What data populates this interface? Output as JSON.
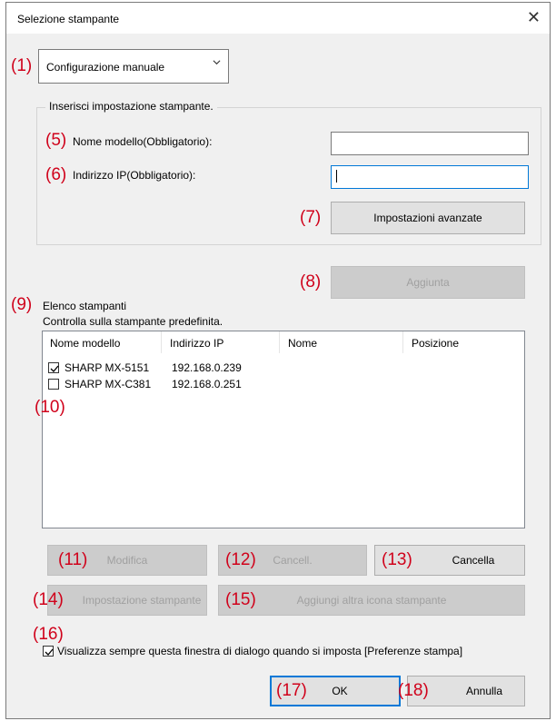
{
  "window": {
    "title": "Selezione stampante",
    "close_glyph": "✕"
  },
  "markers": {
    "m1": "(1)",
    "m5": "(5)",
    "m6": "(6)",
    "m7": "(7)",
    "m8": "(8)",
    "m9": "(9)",
    "m10": "(10)",
    "m11": "(11)",
    "m12": "(12)",
    "m13": "(13)",
    "m14": "(14)",
    "m15": "(15)",
    "m16": "(16)",
    "m17": "(17)",
    "m18": "(18)"
  },
  "config": {
    "selected": "Configurazione manuale"
  },
  "group": {
    "label": "Inserisci impostazione stampante.",
    "model_name_label": "Nome modello(Obbligatorio):",
    "model_name_value": "",
    "ip_label": "Indirizzo IP(Obbligatorio):",
    "ip_value": "",
    "advanced_button": "Impostazioni avanzate"
  },
  "add_button": "Aggiunta",
  "printer_list": {
    "title": "Elenco stampanti",
    "subtitle": "Controlla sulla stampante predefinita.",
    "columns": [
      "Nome modello",
      "Indirizzo IP",
      "Nome",
      "Posizione"
    ],
    "rows": [
      {
        "checked": true,
        "model": "SHARP MX-5151",
        "ip": "192.168.0.239",
        "name": "",
        "position": ""
      },
      {
        "checked": false,
        "model": "SHARP MX-C381",
        "ip": "192.168.0.251",
        "name": "",
        "position": ""
      }
    ]
  },
  "buttons": {
    "modify": "Modifica",
    "cancel_entry": "Cancell.",
    "delete": "Cancella",
    "printer_settings": "Impostazione stampante",
    "add_icon": "Aggiungi altra icona stampante",
    "ok": "OK",
    "cancel": "Annulla"
  },
  "always_show": {
    "checked": true,
    "label": "Visualizza sempre questa finestra di dialogo quando si imposta [Preferenze stampa]"
  },
  "colors": {
    "marker": "#d0021b",
    "focus": "#0078d7",
    "dialog_bg": "#f0f0f0"
  },
  "icons": {
    "close": "close-icon",
    "dropdown": "chevron-down-icon",
    "check": "check-icon"
  }
}
